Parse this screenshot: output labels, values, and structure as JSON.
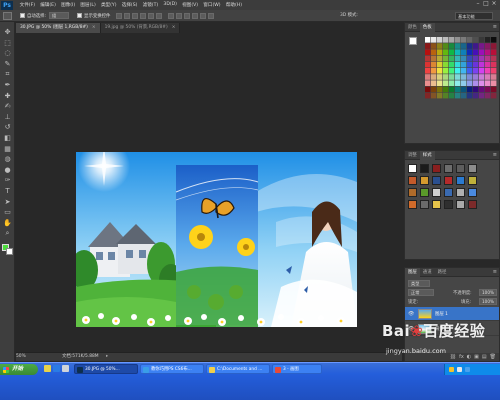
{
  "app": {
    "logo": "Ps"
  },
  "menu": [
    "文件(F)",
    "编辑(E)",
    "图像(I)",
    "图层(L)",
    "类型(Y)",
    "选择(S)",
    "滤镜(T)",
    "3D(D)",
    "视图(V)",
    "窗口(W)",
    "帮助(H)"
  ],
  "window_controls": [
    "–",
    "□",
    "×"
  ],
  "options": {
    "auto_select_label": "自动选择:",
    "auto_select_value": "组",
    "transform_label": "显示变换控件",
    "mode_3d_label": "3D 模式:",
    "workspace": "基本功能"
  },
  "tabs": [
    {
      "label": "30.JPG @ 50% (图层 1,RGB/8#)",
      "close": "×",
      "active": true
    },
    {
      "label": "19.jpg @ 50% (背景,RGB/8#)",
      "close": "×",
      "active": false
    }
  ],
  "tools": [
    {
      "icon": "move-icon",
      "glyph": "✥"
    },
    {
      "icon": "marquee-icon",
      "glyph": "⬚"
    },
    {
      "icon": "lasso-icon",
      "glyph": "◌"
    },
    {
      "icon": "quick-select-icon",
      "glyph": "✎"
    },
    {
      "icon": "crop-icon",
      "glyph": "⌗"
    },
    {
      "icon": "eyedropper-icon",
      "glyph": "✒"
    },
    {
      "icon": "healing-brush-icon",
      "glyph": "✚"
    },
    {
      "icon": "brush-icon",
      "glyph": "✍"
    },
    {
      "icon": "clone-stamp-icon",
      "glyph": "⊥"
    },
    {
      "icon": "history-brush-icon",
      "glyph": "↺"
    },
    {
      "icon": "eraser-icon",
      "glyph": "◧"
    },
    {
      "icon": "gradient-icon",
      "glyph": "▦"
    },
    {
      "icon": "blur-icon",
      "glyph": "◍"
    },
    {
      "icon": "dodge-icon",
      "glyph": "●"
    },
    {
      "icon": "pen-icon",
      "glyph": "✑"
    },
    {
      "icon": "type-icon",
      "glyph": "T"
    },
    {
      "icon": "path-select-icon",
      "glyph": "➤"
    },
    {
      "icon": "shape-icon",
      "glyph": "▭"
    },
    {
      "icon": "hand-icon",
      "glyph": "✋"
    },
    {
      "icon": "zoom-icon",
      "glyph": "⌕"
    }
  ],
  "colors": {
    "foreground": "#4ddd3d",
    "background": "#ffffff",
    "accent": "#3874c8"
  },
  "status": {
    "zoom": "50%",
    "doc": "文档:571K/5.88M",
    "arrow": "▸"
  },
  "panels": {
    "swatches": {
      "tabs": [
        "颜色",
        "色板"
      ],
      "active": 1,
      "menu": "≡"
    },
    "styles": {
      "tabs": [
        "调整",
        "样式"
      ],
      "active": 1,
      "menu": "≡"
    },
    "layers": {
      "tabs": [
        "图层",
        "通道",
        "路径"
      ],
      "active": 0,
      "menu": "≡",
      "kind_label": "类型",
      "blend_mode": "正常",
      "opacity_label": "不透明度:",
      "opacity_value": "100%",
      "lock_label": "锁定:",
      "fill_label": "填充:",
      "fill_value": "100%",
      "items": [
        {
          "name": "图层 1",
          "selected": true
        },
        {
          "name": "背景",
          "selected": false
        }
      ],
      "footer_icons": [
        "⛓",
        "fx",
        "◐",
        "▣",
        "▤",
        "🗑"
      ]
    }
  },
  "taskbar": {
    "start": "开始",
    "buttons": [
      {
        "label": "30.JPG @ 50%...",
        "active": true
      },
      {
        "label": "教你巧用PS CS6布...",
        "active": false
      },
      {
        "label": "C:\\Documents and ...",
        "active": false
      },
      {
        "label": "3 - 画图",
        "active": false
      }
    ]
  },
  "watermark": {
    "logo_a": "Bai",
    "logo_b": "百度",
    "logo_c": "经验",
    "url": "jingyan.baidu.com"
  }
}
